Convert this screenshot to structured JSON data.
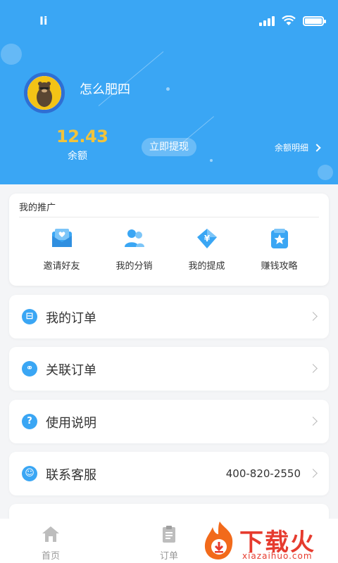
{
  "status_bar": {
    "carrier_glyph": "Ii",
    "signal_icon": "signal-icon",
    "wifi_icon": "wifi-icon",
    "battery_icon": "battery-icon"
  },
  "profile": {
    "nickname": "怎么肥四",
    "avatar_icon": "avatar-bear-icon"
  },
  "balance": {
    "value": "12.43",
    "label": "余额",
    "withdraw_label": "立即提现",
    "detail_label": "余额明细"
  },
  "promotion": {
    "title": "我的推广",
    "items": [
      {
        "label": "邀请好友",
        "icon": "invite-envelope-icon"
      },
      {
        "label": "我的分销",
        "icon": "users-icon"
      },
      {
        "label": "我的提成",
        "icon": "yuan-tag-icon"
      },
      {
        "label": "赚钱攻略",
        "icon": "star-bag-icon"
      }
    ]
  },
  "menu": [
    {
      "label": "我的订单",
      "icon": "order-icon",
      "glyph": "⊟"
    },
    {
      "label": "关联订单",
      "icon": "link-icon",
      "glyph": "⚭"
    },
    {
      "label": "使用说明",
      "icon": "question-icon",
      "glyph": "?"
    },
    {
      "label": "联系客服",
      "icon": "headset-icon",
      "glyph": "☺",
      "value": "400-820-2550"
    }
  ],
  "bottom_nav": [
    {
      "label": "首页",
      "icon": "home-icon"
    },
    {
      "label": "订单",
      "icon": "clipboard-icon"
    }
  ],
  "watermark": {
    "text": "下载火",
    "sub": "xiazaihuo.com"
  },
  "colors": {
    "primary": "#3aa6f4",
    "balance": "#f2c33a",
    "watermark": "#e63b2e"
  }
}
